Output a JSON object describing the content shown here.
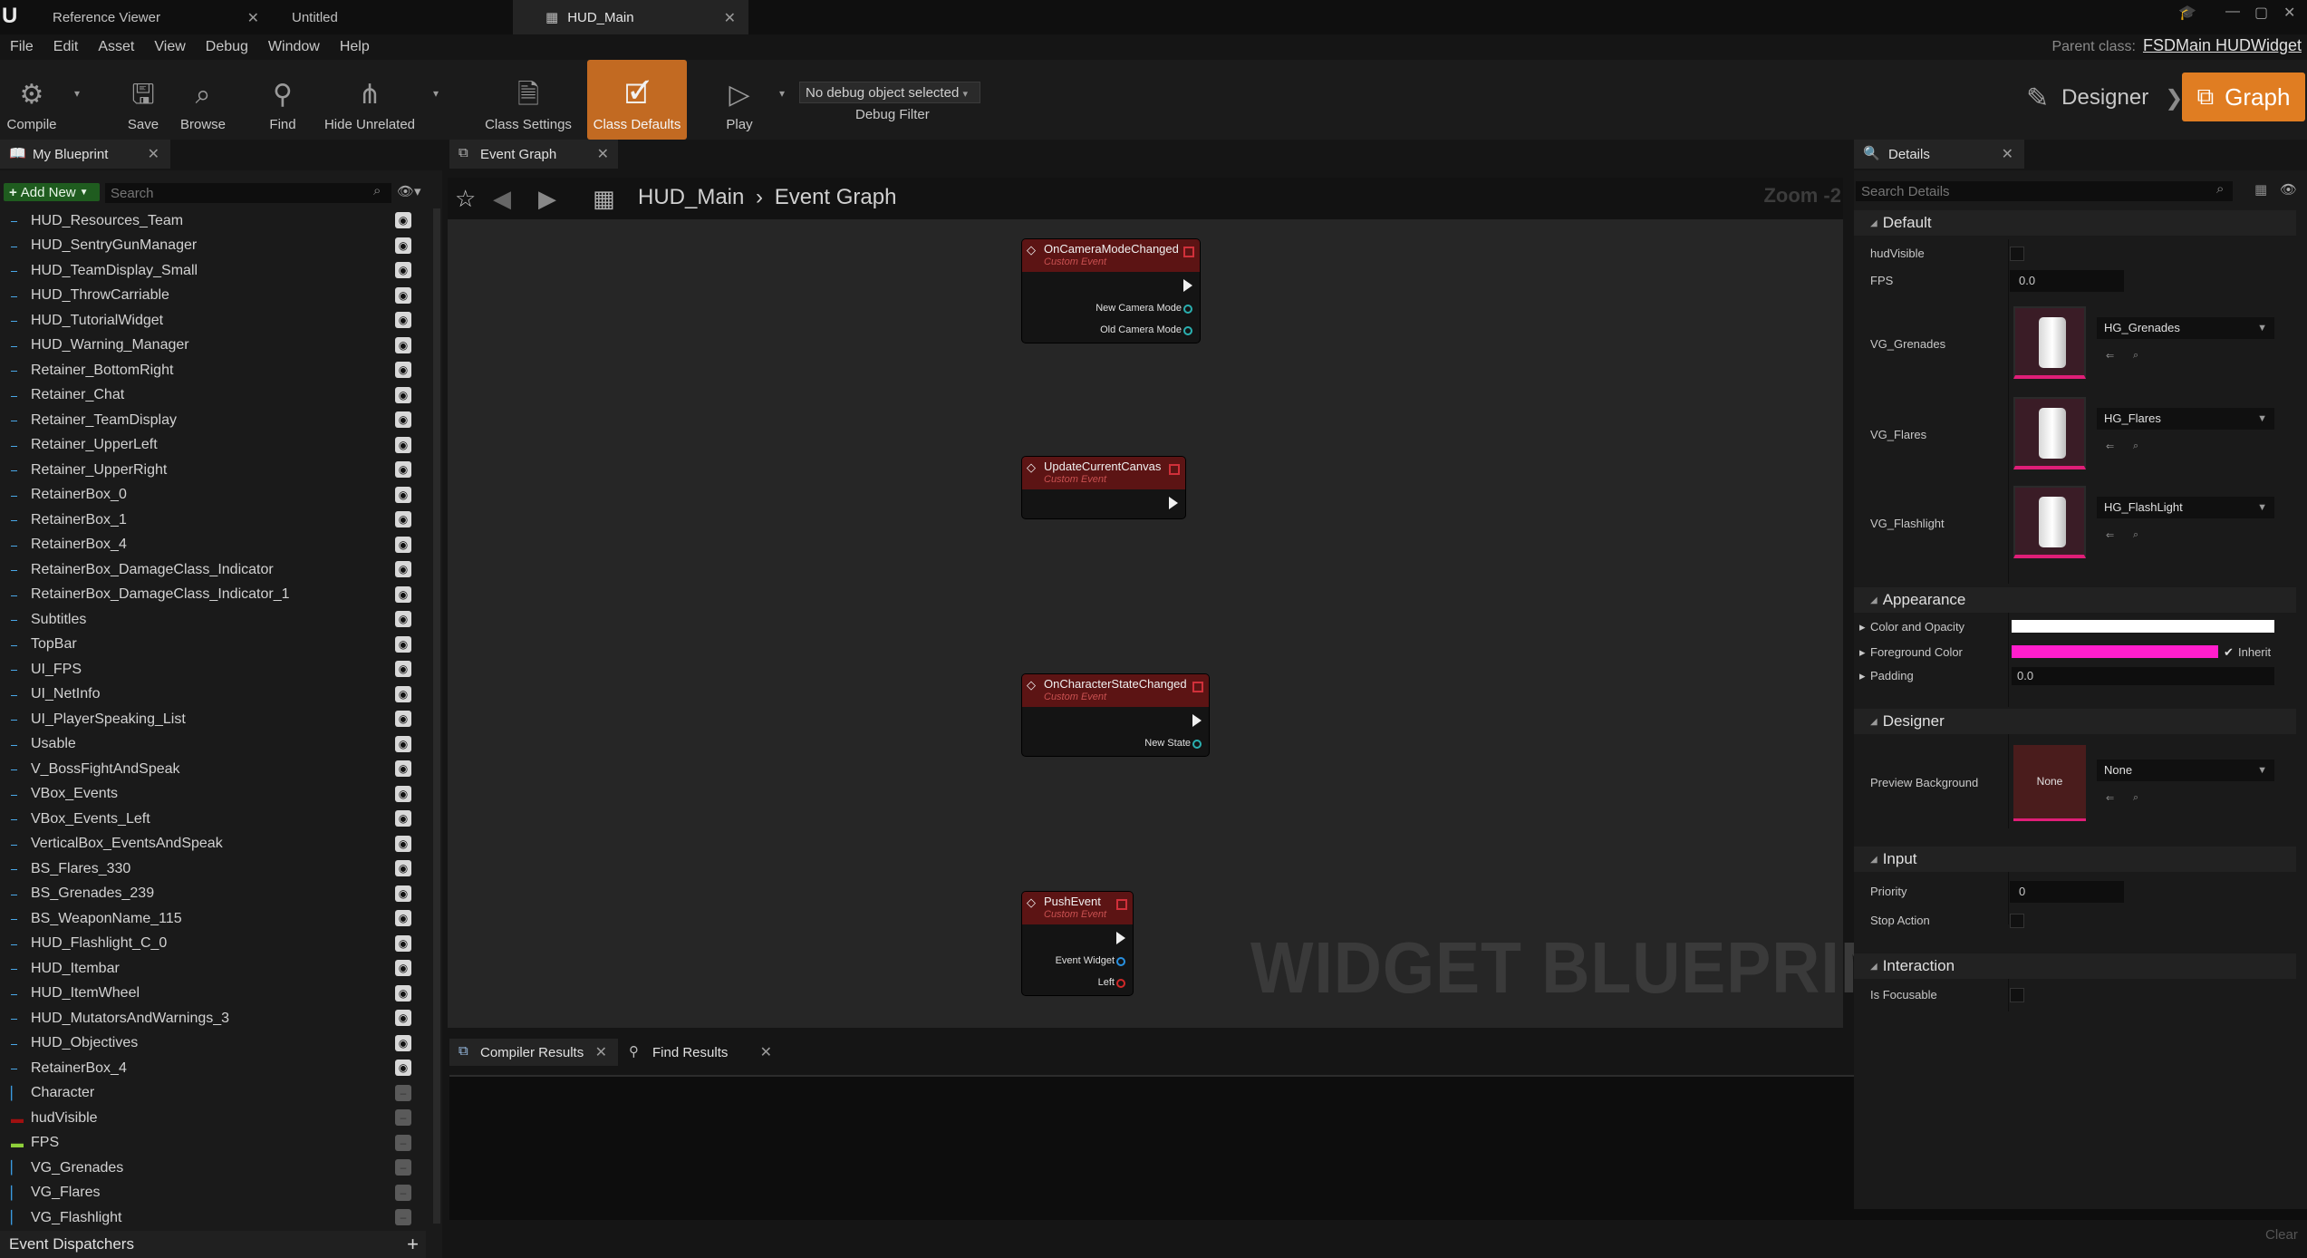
{
  "title_bar": {
    "tabs": [
      {
        "label": "Reference Viewer"
      },
      {
        "label": "Untitled"
      },
      {
        "label": "HUD_Main"
      }
    ]
  },
  "menu": [
    "File",
    "Edit",
    "Asset",
    "View",
    "Debug",
    "Window",
    "Help"
  ],
  "parent_class": {
    "label": "Parent class:",
    "value": "FSDMain HUDWidget"
  },
  "toolbar": {
    "compile": "Compile",
    "save": "Save",
    "browse": "Browse",
    "find": "Find",
    "hide_unrelated": "Hide Unrelated",
    "class_settings": "Class Settings",
    "class_defaults": "Class Defaults",
    "play": "Play",
    "debug_select": "No debug object selected",
    "debug_filter": "Debug Filter",
    "designer": "Designer",
    "graph": "Graph"
  },
  "my_blueprint": {
    "tab_label": "My Blueprint",
    "add_new": "Add New",
    "search_placeholder": "Search",
    "variables": [
      {
        "name": "HUD_Resources_Team",
        "icon": "widget-icon",
        "visible": true
      },
      {
        "name": "HUD_SentryGunManager",
        "icon": "widget-icon",
        "visible": true
      },
      {
        "name": "HUD_TeamDisplay_Small",
        "icon": "widget-icon",
        "visible": true
      },
      {
        "name": "HUD_ThrowCarriable",
        "icon": "widget-icon",
        "visible": true
      },
      {
        "name": "HUD_TutorialWidget",
        "icon": "widget-icon",
        "visible": true
      },
      {
        "name": "HUD_Warning_Manager",
        "icon": "widget-icon",
        "visible": true
      },
      {
        "name": "Retainer_BottomRight",
        "icon": "widget-icon",
        "visible": true
      },
      {
        "name": "Retainer_Chat",
        "icon": "widget-icon",
        "visible": true
      },
      {
        "name": "Retainer_TeamDisplay",
        "icon": "widget-icon",
        "visible": true
      },
      {
        "name": "Retainer_UpperLeft",
        "icon": "widget-icon",
        "visible": true
      },
      {
        "name": "Retainer_UpperRight",
        "icon": "widget-icon",
        "visible": true
      },
      {
        "name": "RetainerBox_0",
        "icon": "widget-icon",
        "visible": true
      },
      {
        "name": "RetainerBox_1",
        "icon": "widget-icon",
        "visible": true
      },
      {
        "name": "RetainerBox_4",
        "icon": "widget-icon",
        "visible": true
      },
      {
        "name": "RetainerBox_DamageClass_Indicator",
        "icon": "widget-icon",
        "visible": true
      },
      {
        "name": "RetainerBox_DamageClass_Indicator_1",
        "icon": "widget-icon",
        "visible": true
      },
      {
        "name": "Subtitles",
        "icon": "widget-icon",
        "visible": true
      },
      {
        "name": "TopBar",
        "icon": "widget-icon",
        "visible": true
      },
      {
        "name": "UI_FPS",
        "icon": "widget-icon",
        "visible": true
      },
      {
        "name": "UI_NetInfo",
        "icon": "widget-icon",
        "visible": true
      },
      {
        "name": "UI_PlayerSpeaking_List",
        "icon": "widget-icon",
        "visible": true
      },
      {
        "name": "Usable",
        "icon": "widget-icon",
        "visible": true
      },
      {
        "name": "V_BossFightAndSpeak",
        "icon": "widget-icon",
        "visible": true
      },
      {
        "name": "VBox_Events",
        "icon": "widget-icon",
        "visible": true
      },
      {
        "name": "VBox_Events_Left",
        "icon": "widget-icon",
        "visible": true
      },
      {
        "name": "VerticalBox_EventsAndSpeak",
        "icon": "widget-icon",
        "visible": true
      },
      {
        "name": "BS_Flares_330",
        "icon": "widget-icon",
        "visible": true
      },
      {
        "name": "BS_Grenades_239",
        "icon": "widget-icon",
        "visible": true
      },
      {
        "name": "BS_WeaponName_115",
        "icon": "widget-icon",
        "visible": true
      },
      {
        "name": "HUD_Flashlight_C_0",
        "icon": "widget-icon",
        "visible": true
      },
      {
        "name": "HUD_Itembar",
        "icon": "widget-icon",
        "visible": true
      },
      {
        "name": "HUD_ItemWheel",
        "icon": "widget-icon",
        "visible": true
      },
      {
        "name": "HUD_MutatorsAndWarnings_3",
        "icon": "widget-icon",
        "visible": true
      },
      {
        "name": "HUD_Objectives",
        "icon": "widget-icon",
        "visible": true
      },
      {
        "name": "RetainerBox_4",
        "icon": "widget-icon",
        "visible": true
      },
      {
        "name": "Character",
        "icon": "object-icon",
        "visible": false
      },
      {
        "name": "hudVisible",
        "icon": "bool-icon",
        "visible": false
      },
      {
        "name": "FPS",
        "icon": "float-icon",
        "visible": false
      },
      {
        "name": "VG_Grenades",
        "icon": "object-icon",
        "visible": false
      },
      {
        "name": "VG_Flares",
        "icon": "object-icon",
        "visible": false
      },
      {
        "name": "VG_Flashlight",
        "icon": "object-icon",
        "visible": false
      }
    ],
    "event_dispatchers": "Event Dispatchers"
  },
  "graph": {
    "tab_label": "Event Graph",
    "breadcrumb_root": "HUD_Main",
    "breadcrumb_current": "Event Graph",
    "zoom": "Zoom -2",
    "watermark": "WIDGET BLUEPRINT",
    "nodes": [
      {
        "title": "OnCameraModeChanged",
        "subtitle": "Custom Event",
        "pins": [
          "New Camera Mode",
          "Old Camera Mode"
        ]
      },
      {
        "title": "UpdateCurrentCanvas",
        "subtitle": "Custom Event",
        "pins": []
      },
      {
        "title": "OnCharacterStateChanged",
        "subtitle": "Custom Event",
        "pins": [
          "New State"
        ]
      },
      {
        "title": "PushEvent",
        "subtitle": "Custom Event",
        "pins": [
          "Event Widget",
          "Left"
        ]
      }
    ]
  },
  "bottom": {
    "compiler_results": "Compiler Results",
    "find_results": "Find Results",
    "clear": "Clear"
  },
  "details": {
    "tab_label": "Details",
    "search_placeholder": "Search Details",
    "sections": {
      "default": "Default",
      "appearance": "Appearance",
      "designer": "Designer",
      "input": "Input",
      "interaction": "Interaction"
    },
    "props": {
      "hudVisible": "hudVisible",
      "fps_label": "FPS",
      "fps_value": "0.0",
      "vg_grenades": "VG_Grenades",
      "vg_grenades_asset": "HG_Grenades",
      "vg_flares": "VG_Flares",
      "vg_flares_asset": "HG_Flares",
      "vg_flashlight": "VG_Flashlight",
      "vg_flashlight_asset": "HG_FlashLight",
      "color_opacity": "Color and Opacity",
      "foreground": "Foreground Color",
      "inherit": "Inherit",
      "padding": "Padding",
      "padding_value": "0.0",
      "preview_bg": "Preview Background",
      "preview_thumb": "None",
      "preview_value": "None",
      "priority": "Priority",
      "priority_value": "0",
      "stop_action": "Stop Action",
      "is_focusable": "Is Focusable"
    },
    "colors": {
      "color_opacity": "#ffffff",
      "foreground": "#ff1ecc"
    }
  }
}
